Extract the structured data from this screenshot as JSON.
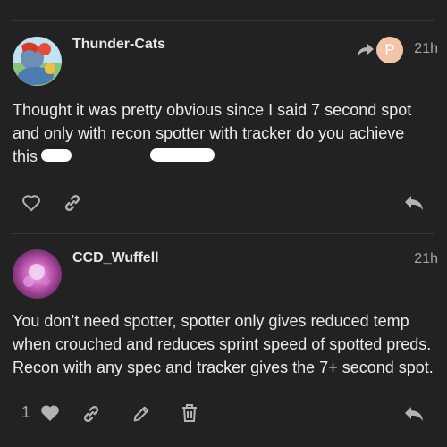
{
  "posts": [
    {
      "username": "Thunder-Cats",
      "time": "21h",
      "reply_to_initial": "P",
      "body": "Thought it was pretty obvious since I said 7 second spot and only with recon spotter with tracker do you achieve this",
      "icons": [
        "heart-icon",
        "link-icon",
        "reply-icon",
        "share-arrow-icon"
      ]
    },
    {
      "username": "CCD_Wuffell",
      "time": "21h",
      "body": "You don’t need spotter, spotter only gives reduced temp when crouched and reduces sprint speed of spotted preds. Recon with any spec and tracker gives the 7+ second spot.",
      "like_count": "1",
      "icons": [
        "heart-icon",
        "link-icon",
        "pencil-icon",
        "trash-icon",
        "reply-icon"
      ]
    }
  ],
  "colors": {
    "background": "#222222",
    "text": "#ececec",
    "muted": "#a8a8a8",
    "divider": "#3a3a3a",
    "reply_avatar": "#f2c4a8"
  }
}
